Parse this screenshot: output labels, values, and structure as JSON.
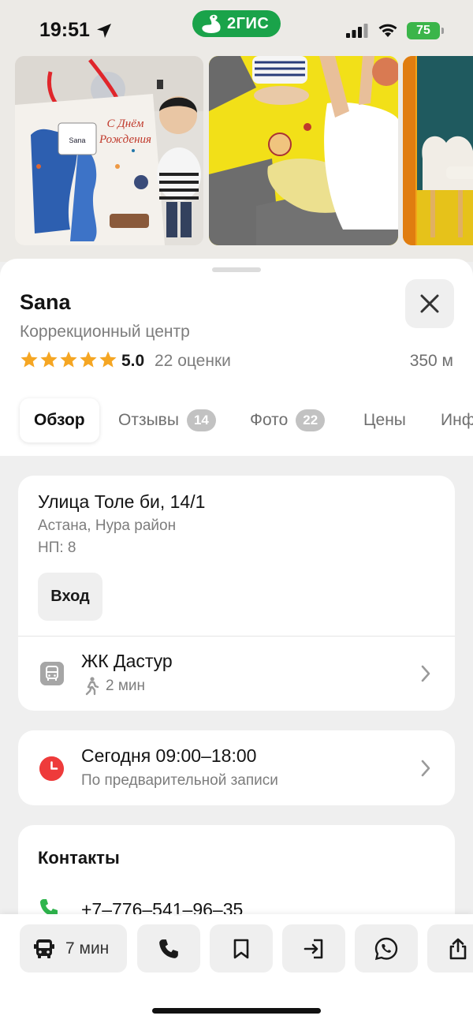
{
  "status_bar": {
    "time": "19:51",
    "brand_badge": "2ГИС",
    "battery": "75"
  },
  "gallery": {
    "photos": [
      {
        "icon": "gift-bag-photo",
        "bag_text_top": "С Днём",
        "bag_text_bottom": "Рождения",
        "bag_brand": "Sana"
      },
      {
        "icon": "playroom-photo"
      },
      {
        "icon": "chair-photo"
      }
    ]
  },
  "place": {
    "name": "Sana",
    "category": "Коррекционный центр",
    "rating": "5.0",
    "ratings_count": "22 оценки",
    "stars": 5,
    "distance": "350 м"
  },
  "tabs": [
    {
      "label": "Обзор",
      "active": true
    },
    {
      "label": "Отзывы",
      "badge": "14"
    },
    {
      "label": "Фото",
      "badge": "22"
    },
    {
      "label": "Цены"
    },
    {
      "label": "Инф"
    }
  ],
  "address": {
    "street": "Улица Толе би, 14/1",
    "city": "Астана, Нура район",
    "np": "НП: 8",
    "entrance_button": "Вход",
    "stop_name": "ЖК Дастур",
    "walk_time": "2 мин"
  },
  "hours": {
    "today": "Сегодня 09:00–18:00",
    "note": "По предварительной записи"
  },
  "contacts": {
    "title": "Контакты",
    "phone": "+7‒776‒541‒96‒35"
  },
  "bottom_bar": {
    "route_time": "7 мин",
    "actions": [
      "bus-icon",
      "phone-icon",
      "bookmark-icon",
      "entrance-icon",
      "whatsapp-icon",
      "share-icon"
    ]
  },
  "colors": {
    "brand_green": "#1aa34a",
    "star": "#f5a623",
    "clock_red": "#ee3b3b",
    "phone_green": "#2eb54c",
    "battery_green": "#3bb54a"
  }
}
